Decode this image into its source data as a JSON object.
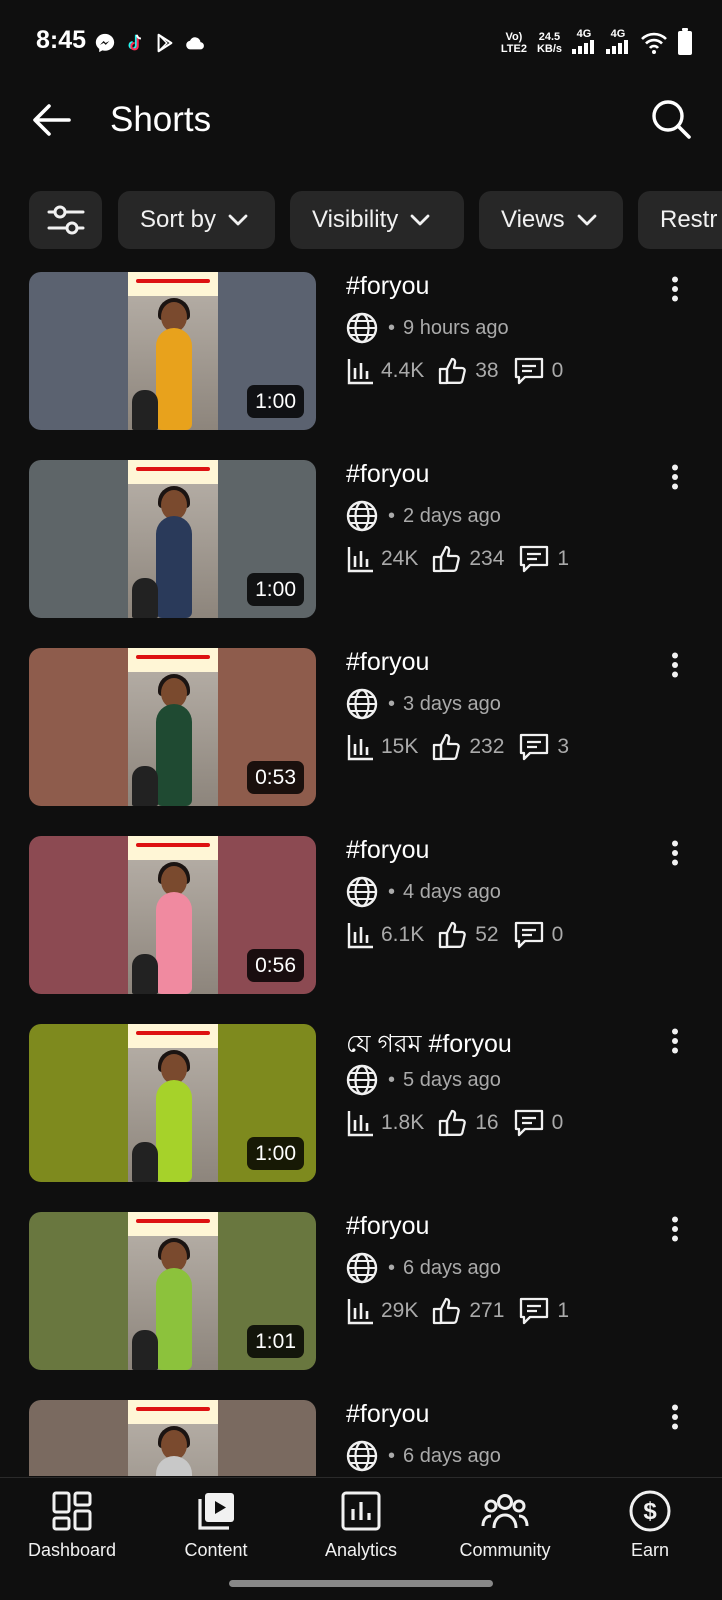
{
  "status_bar": {
    "time": "8:45",
    "network_type": "LTE2",
    "net_speed_value": "24.5",
    "net_speed_unit": "KB/s",
    "signal_1_label": "4G",
    "signal_2_label": "4G",
    "app_icons": [
      "messenger-icon",
      "tiktok-icon",
      "play-store-icon",
      "cloud-icon"
    ]
  },
  "header": {
    "title": "Shorts"
  },
  "filters": {
    "chips": [
      {
        "label": "Sort by"
      },
      {
        "label": "Visibility"
      },
      {
        "label": "Views"
      },
      {
        "label": "Restr"
      }
    ]
  },
  "videos": [
    {
      "title": "#foryou",
      "time_ago": "9 hours ago",
      "views": "4.4K",
      "likes": "38",
      "comments": "0",
      "duration": "1:00",
      "bg_color": "#5b6270",
      "outfit_color": "#e8a21c"
    },
    {
      "title": "#foryou",
      "time_ago": "2 days ago",
      "views": "24K",
      "likes": "234",
      "comments": "1",
      "duration": "1:00",
      "bg_color": "#5e6568",
      "outfit_color": "#2a3a5a"
    },
    {
      "title": "#foryou",
      "time_ago": "3 days ago",
      "views": "15K",
      "likes": "232",
      "comments": "3",
      "duration": "0:53",
      "bg_color": "#8e5c4c",
      "outfit_color": "#1f4a32"
    },
    {
      "title": "#foryou",
      "time_ago": "4 days ago",
      "views": "6.1K",
      "likes": "52",
      "comments": "0",
      "duration": "0:56",
      "bg_color": "#8c4a52",
      "outfit_color": "#f08aa0"
    },
    {
      "title": "যে গরম #foryou",
      "time_ago": "5 days ago",
      "views": "1.8K",
      "likes": "16",
      "comments": "0",
      "duration": "1:00",
      "bg_color": "#7e8a1e",
      "outfit_color": "#a6d22a"
    },
    {
      "title": "#foryou",
      "time_ago": "6 days ago",
      "views": "29K",
      "likes": "271",
      "comments": "1",
      "duration": "1:01",
      "bg_color": "#69773f",
      "outfit_color": "#8cc23c"
    },
    {
      "title": "#foryou",
      "time_ago": "6 days ago",
      "views": "",
      "likes": "",
      "comments": "",
      "duration": "",
      "bg_color": "#7a6a60",
      "outfit_color": "#c8c8c8"
    }
  ],
  "bottom_nav": [
    {
      "label": "Dashboard",
      "icon": "dashboard-icon"
    },
    {
      "label": "Content",
      "icon": "content-icon"
    },
    {
      "label": "Analytics",
      "icon": "analytics-icon"
    },
    {
      "label": "Community",
      "icon": "community-icon"
    },
    {
      "label": "Earn",
      "icon": "earn-icon"
    }
  ]
}
